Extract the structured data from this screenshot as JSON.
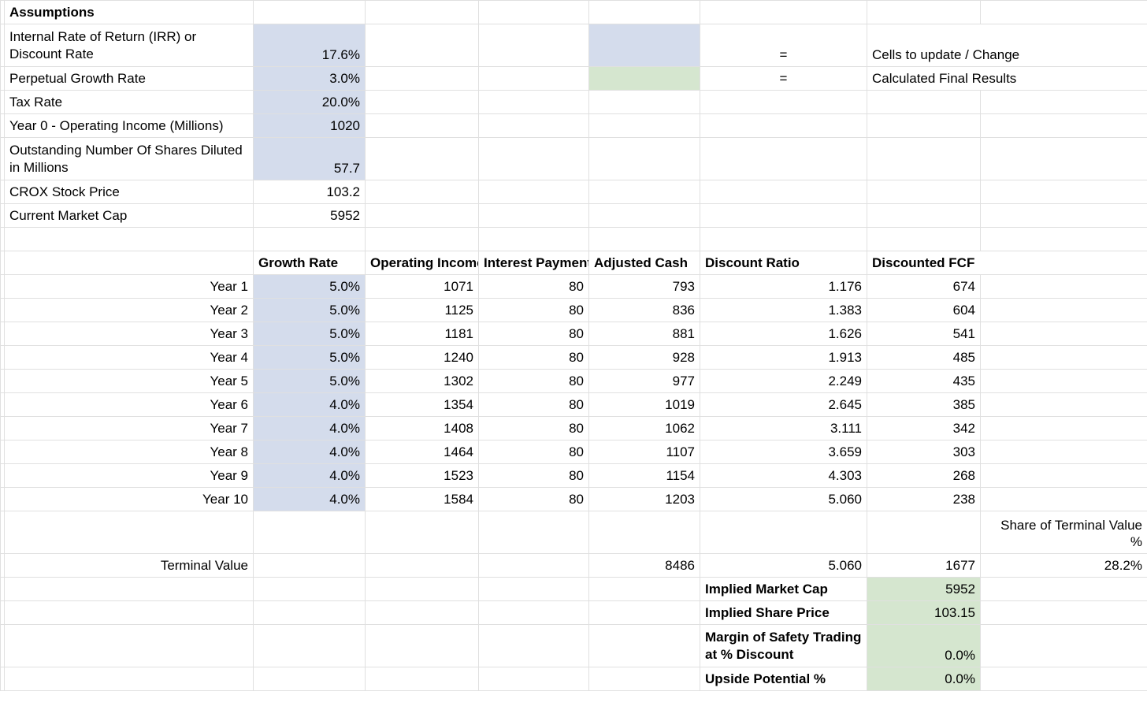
{
  "section_assumptions_label": "Assumptions",
  "assumptions": {
    "irr_label": "Internal Rate of Return (IRR) or Discount Rate",
    "irr_value": "17.6%",
    "pgr_label": "Perpetual Growth Rate",
    "pgr_value": "3.0%",
    "tax_label": "Tax Rate",
    "tax_value": "20.0%",
    "y0_label": "Year 0 - Operating Income (Millions)",
    "y0_value": "1020",
    "shares_label": "Outstanding Number Of Shares Diluted in Millions",
    "shares_value": "57.7",
    "price_label": "CROX Stock Price",
    "price_value": "103.2",
    "mcap_label": "Current Market Cap",
    "mcap_value": "5952"
  },
  "legend": {
    "eq1": "=",
    "eq2": "=",
    "update_label": "Cells to update / Change",
    "calc_label": "Calculated Final Results"
  },
  "headers": {
    "growth": "Growth Rate",
    "opinc": "Operating Income",
    "intpay": "Interest Payments",
    "adjcash": "Adjusted Cash",
    "discratio": "Discount Ratio",
    "discfcf": "Discounted FCF"
  },
  "years": [
    {
      "label": "Year 1",
      "growth": "5.0%",
      "opinc": "1071",
      "intpay": "80",
      "adjcash": "793",
      "ratio": "1.176",
      "dfcf": "674"
    },
    {
      "label": "Year 2",
      "growth": "5.0%",
      "opinc": "1125",
      "intpay": "80",
      "adjcash": "836",
      "ratio": "1.383",
      "dfcf": "604"
    },
    {
      "label": "Year 3",
      "growth": "5.0%",
      "opinc": "1181",
      "intpay": "80",
      "adjcash": "881",
      "ratio": "1.626",
      "dfcf": "541"
    },
    {
      "label": "Year 4",
      "growth": "5.0%",
      "opinc": "1240",
      "intpay": "80",
      "adjcash": "928",
      "ratio": "1.913",
      "dfcf": "485"
    },
    {
      "label": "Year 5",
      "growth": "5.0%",
      "opinc": "1302",
      "intpay": "80",
      "adjcash": "977",
      "ratio": "2.249",
      "dfcf": "435"
    },
    {
      "label": "Year 6",
      "growth": "4.0%",
      "opinc": "1354",
      "intpay": "80",
      "adjcash": "1019",
      "ratio": "2.645",
      "dfcf": "385"
    },
    {
      "label": "Year 7",
      "growth": "4.0%",
      "opinc": "1408",
      "intpay": "80",
      "adjcash": "1062",
      "ratio": "3.111",
      "dfcf": "342"
    },
    {
      "label": "Year 8",
      "growth": "4.0%",
      "opinc": "1464",
      "intpay": "80",
      "adjcash": "1107",
      "ratio": "3.659",
      "dfcf": "303"
    },
    {
      "label": "Year 9",
      "growth": "4.0%",
      "opinc": "1523",
      "intpay": "80",
      "adjcash": "1154",
      "ratio": "4.303",
      "dfcf": "268"
    },
    {
      "label": "Year 10",
      "growth": "4.0%",
      "opinc": "1584",
      "intpay": "80",
      "adjcash": "1203",
      "ratio": "5.060",
      "dfcf": "238"
    }
  ],
  "share_tv_label": "Share of Terminal Value %",
  "terminal": {
    "label": "Terminal Value",
    "adjcash": "8486",
    "ratio": "5.060",
    "dfcf": "1677",
    "share_pct": "28.2%"
  },
  "results": {
    "mcap_label": "Implied Market Cap",
    "mcap_value": "5952",
    "price_label": "Implied Share Price",
    "price_value": "103.15",
    "mos_label": "Margin of Safety Trading at % Discount",
    "mos_value": "0.0%",
    "upside_label": "Upside Potential %",
    "upside_value": "0.0%"
  }
}
